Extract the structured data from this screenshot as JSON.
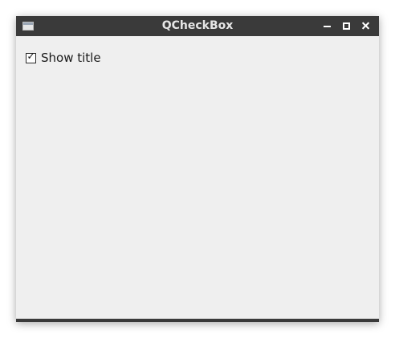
{
  "window": {
    "title": "QCheckBox"
  },
  "titlebar": {
    "app_icon": "window-app-icon",
    "buttons": {
      "minimize": "minimize-icon",
      "maximize": "maximize-icon",
      "close": "close-icon"
    }
  },
  "content": {
    "checkbox": {
      "label": "Show title",
      "checked": true,
      "check_glyph": "✓"
    }
  },
  "colors": {
    "titlebar_bg": "#3a3a3a",
    "window_bg": "#efefef",
    "title_text": "#e6e6e6"
  }
}
